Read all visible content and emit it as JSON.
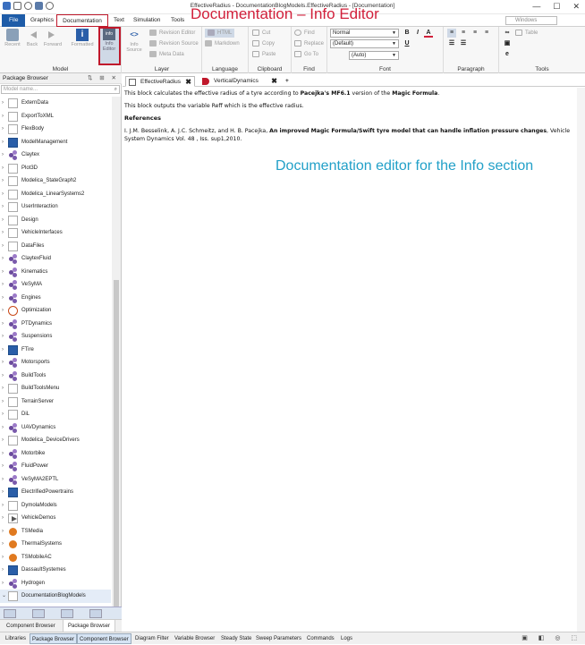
{
  "window": {
    "title": "EffectiveRadius - DocumentationBlogModels.EffectiveRadius - [Documentation]",
    "controls": [
      "—",
      "☐",
      "✕"
    ]
  },
  "menu": {
    "tabs": [
      {
        "label": "File"
      },
      {
        "label": "Graphics"
      },
      {
        "label": "Documentation"
      },
      {
        "label": "Text"
      },
      {
        "label": "Simulation"
      },
      {
        "label": "Tools"
      }
    ],
    "windows_combo": "Windows"
  },
  "ribbon": {
    "model": {
      "label": "Model",
      "recent": "Recent",
      "back": "Back",
      "forward": "Forward",
      "formatted": "Formatted",
      "info_editor": "Info\nEditor",
      "info_icon_text": "info"
    },
    "layer": {
      "label": "Layer",
      "info_source": "Info\nSource",
      "info_icon_text": "info",
      "revision_editor": "Revision Editor",
      "revision_source": "Revision Source",
      "meta_data": "Meta Data"
    },
    "language": {
      "label": "Language",
      "html": "HTML",
      "markdown": "Markdown"
    },
    "clipboard": {
      "label": "Clipboard",
      "cut": "Cut",
      "copy": "Copy",
      "paste": "Paste"
    },
    "find": {
      "label": "Find",
      "find": "Find",
      "replace": "Replace",
      "goto": "Go To"
    },
    "font": {
      "label": "Font",
      "style": "Normal",
      "family": "(Default)",
      "size": "(Auto)",
      "bold": "B",
      "italic": "I",
      "underline": "U",
      "color": "A"
    },
    "paragraph": {
      "label": "Paragraph"
    },
    "tools": {
      "label": "Tools",
      "table": "Table"
    }
  },
  "package_browser": {
    "title": "Package Browser",
    "header_buttons": "⇅ ⊞ ✕",
    "search_placeholder": "Model name...",
    "items": [
      {
        "label": "ExternData",
        "icon": "box"
      },
      {
        "label": "ExportToXML",
        "icon": "box"
      },
      {
        "label": "FlexBody",
        "icon": "box"
      },
      {
        "label": "ModelManagement",
        "icon": "blue"
      },
      {
        "label": "Claytex",
        "icon": "mol"
      },
      {
        "label": "Plot3D",
        "icon": "box"
      },
      {
        "label": "Modelica_StateGraph2",
        "icon": "box"
      },
      {
        "label": "Modelica_LinearSystems2",
        "icon": "box"
      },
      {
        "label": "UserInteraction",
        "icon": "box"
      },
      {
        "label": "Design",
        "icon": "box"
      },
      {
        "label": "VehicleInterfaces",
        "icon": "box"
      },
      {
        "label": "DataFiles",
        "icon": "box"
      },
      {
        "label": "ClaytexFluid",
        "icon": "mol"
      },
      {
        "label": "Kinematics",
        "icon": "mol"
      },
      {
        "label": "VeSyMA",
        "icon": "mol"
      },
      {
        "label": "Engines",
        "icon": "mol"
      },
      {
        "label": "Optimization",
        "icon": "target"
      },
      {
        "label": "PTDynamics",
        "icon": "mol"
      },
      {
        "label": "Suspensions",
        "icon": "mol"
      },
      {
        "label": "FTire",
        "icon": "blue"
      },
      {
        "label": "Motorsports",
        "icon": "mol"
      },
      {
        "label": "BuildTools",
        "icon": "mol"
      },
      {
        "label": "BuildToolsMenu",
        "icon": "box"
      },
      {
        "label": "TerrainServer",
        "icon": "box"
      },
      {
        "label": "DiL",
        "icon": "box"
      },
      {
        "label": "UAVDynamics",
        "icon": "mol"
      },
      {
        "label": "Modelica_DeviceDrivers",
        "icon": "box"
      },
      {
        "label": "Motorbike",
        "icon": "mol"
      },
      {
        "label": "FluidPower",
        "icon": "mol"
      },
      {
        "label": "VeSyMA2EPTL",
        "icon": "mol"
      },
      {
        "label": "ElectrifiedPowertrains",
        "icon": "blue"
      },
      {
        "label": "DymolaModels",
        "icon": "box"
      },
      {
        "label": "VehicleDemos",
        "icon": "play"
      },
      {
        "label": "TSMedia",
        "icon": "orange"
      },
      {
        "label": "ThermalSystems",
        "icon": "orange"
      },
      {
        "label": "TSMobileAC",
        "icon": "orange"
      },
      {
        "label": "DassaultSystemes",
        "icon": "blue"
      },
      {
        "label": "Hydrogen",
        "icon": "mol"
      },
      {
        "label": "DocumentationBlogModels",
        "icon": "box"
      }
    ],
    "bottom_tabs": [
      "Component Browser",
      "Package Browser"
    ]
  },
  "editor": {
    "tabs": [
      {
        "label": "EffectiveRadius",
        "close": "✖"
      },
      {
        "label": "VerticalDynamics",
        "close": "✖"
      },
      {
        "label": "+"
      }
    ],
    "content": {
      "p1_a": "This block calculates the effective radius of a tyre according to ",
      "p1_b": "Pacejka's MF6.1",
      "p1_c": " version of the ",
      "p1_d": "Magic Formula",
      "p1_e": ".",
      "p2": "This block outputs the variable Reff which is the effective radius.",
      "heading": "References",
      "ref_a": "I. J.M. Besselink, A. J.C. Schmeitz, and H. B. Pacejka, ",
      "ref_b": "An improved Magic Formula/Swift tyre model that can handle inflation pressure changes",
      "ref_c": ", Vehicle System Dynamics Vol. 48 , Iss. sup1,2010."
    }
  },
  "status_bar": {
    "tabs": [
      "Libraries",
      "Package Browser",
      "Component Browser",
      "Diagram Filter",
      "Variable Browser",
      "Steady State",
      "Sweep Parameters",
      "Commands",
      "Logs"
    ],
    "right_icons": "▣ ◧ ◎ ⬚"
  },
  "annotations": {
    "top": "Documentation – Info Editor",
    "middle": "Documentation editor for the Info section"
  },
  "colors": {
    "file_tab": "#1e5ca8",
    "highlight_red": "#c0182b",
    "annotation_teal": "#22a0c8"
  }
}
